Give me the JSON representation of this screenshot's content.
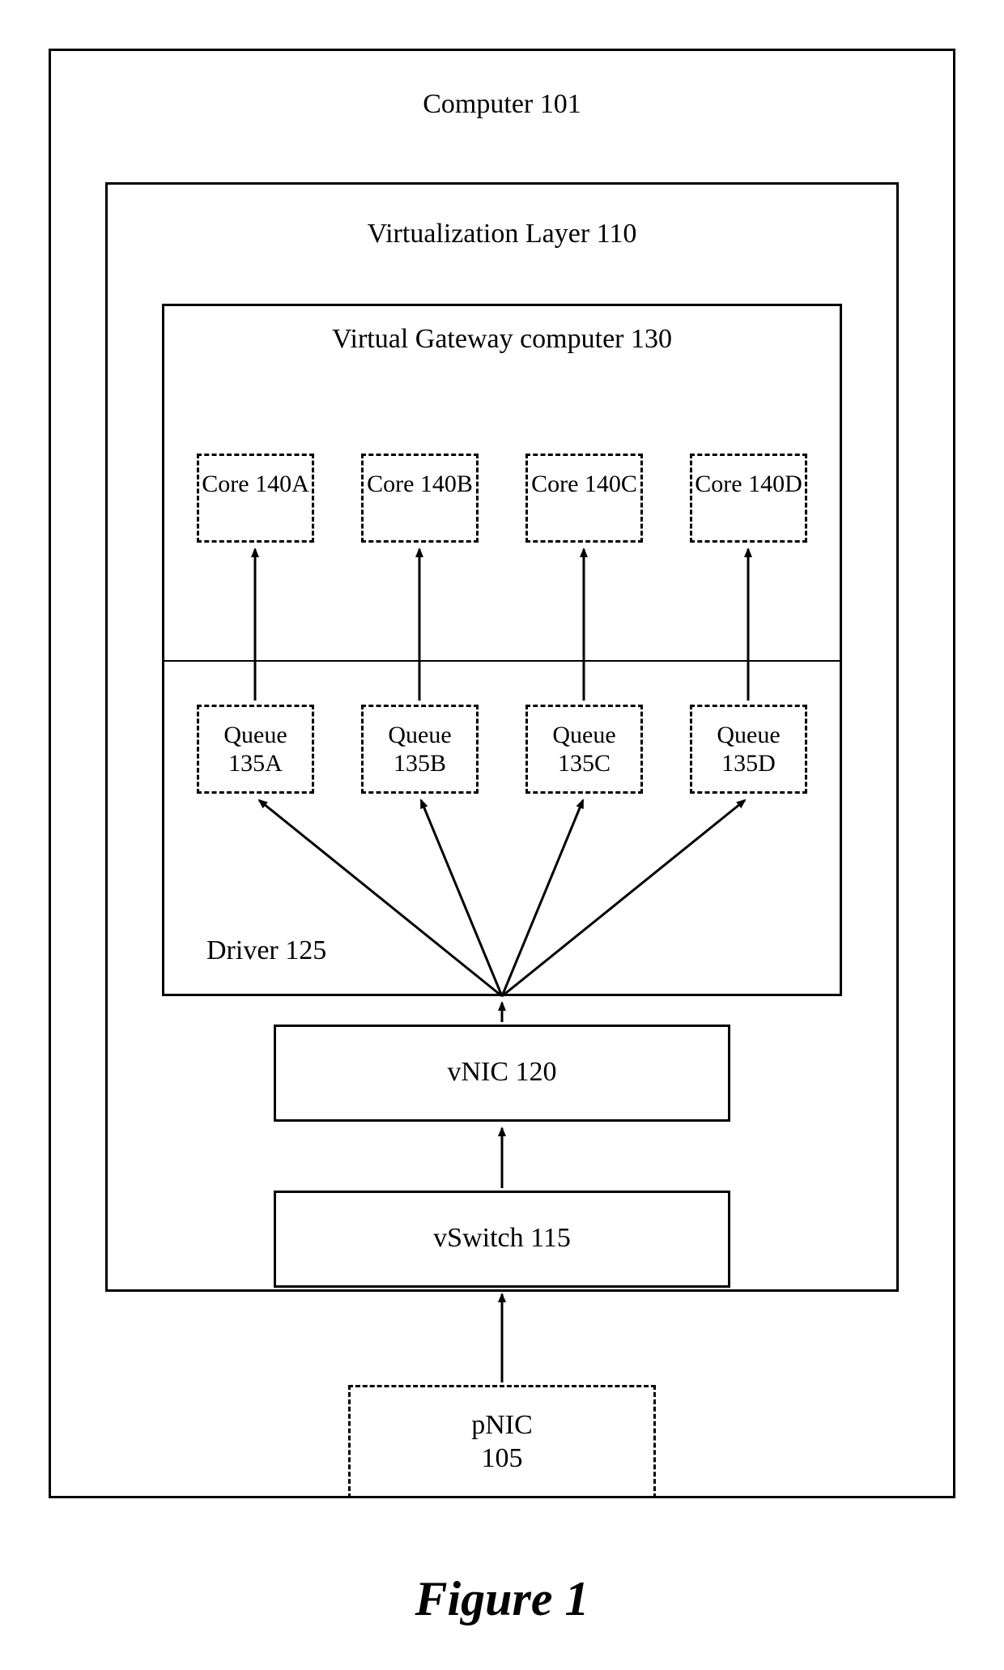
{
  "computer": {
    "label": "Computer 101"
  },
  "virtualization": {
    "label": "Virtualization Layer 110"
  },
  "gateway": {
    "label": "Virtual Gateway computer 130"
  },
  "cores": [
    {
      "label": "Core\n140A"
    },
    {
      "label": "Core\n140B"
    },
    {
      "label": "Core\n140C"
    },
    {
      "label": "Core\n140D"
    }
  ],
  "queues": [
    {
      "label": "Queue\n135A"
    },
    {
      "label": "Queue\n135B"
    },
    {
      "label": "Queue\n135C"
    },
    {
      "label": "Queue\n135D"
    }
  ],
  "driver": {
    "label": "Driver 125"
  },
  "vnic": {
    "label": "vNIC 120"
  },
  "vswitch": {
    "label": "vSwitch 115"
  },
  "pnic": {
    "label": "pNIC\n105"
  },
  "figure": {
    "caption": "Figure 1"
  }
}
